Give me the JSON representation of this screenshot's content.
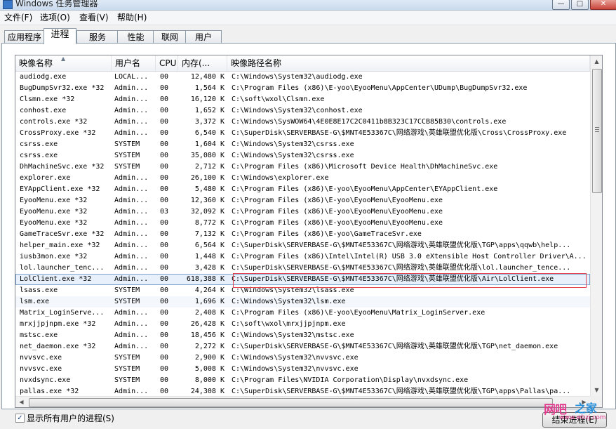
{
  "window": {
    "title": "Windows 任务管理器",
    "min_glyph": "—",
    "max_glyph": "□",
    "close_glyph": "✕"
  },
  "menu": [
    "文件(F)",
    "选项(O)",
    "查看(V)",
    "帮助(H)"
  ],
  "tabs": [
    "应用程序",
    "进程",
    "服务",
    "性能",
    "联网",
    "用户"
  ],
  "active_tab": "进程",
  "columns": {
    "name": "映像名称",
    "user": "用户名",
    "cpu": "CPU",
    "mem": "内存(...",
    "path": "映像路径名称"
  },
  "rows": [
    {
      "name": "audiodg.exe",
      "user": "LOCAL...",
      "cpu": "00",
      "mem": "12,480 K",
      "path": "C:\\Windows\\System32\\audiodg.exe"
    },
    {
      "name": "BugDumpSvr32.exe *32",
      "user": "Admin...",
      "cpu": "00",
      "mem": "1,564 K",
      "path": "C:\\Program Files (x86)\\E-yoo\\EyooMenu\\AppCenter\\UDump\\BugDumpSvr32.exe"
    },
    {
      "name": "Clsmn.exe *32",
      "user": "Admin...",
      "cpu": "00",
      "mem": "16,120 K",
      "path": "C:\\soft\\wxol\\Clsmn.exe"
    },
    {
      "name": "conhost.exe",
      "user": "Admin...",
      "cpu": "00",
      "mem": "1,652 K",
      "path": "C:\\Windows\\System32\\conhost.exe"
    },
    {
      "name": "controls.exe *32",
      "user": "Admin...",
      "cpu": "00",
      "mem": "3,372 K",
      "path": "C:\\Windows\\SysWOW64\\4E0E8E17C2C0411b8B323C17CCB85B30\\controls.exe"
    },
    {
      "name": "CrossProxy.exe *32",
      "user": "Admin...",
      "cpu": "00",
      "mem": "6,540 K",
      "path": "C:\\SuperDisk\\SERVERBASE-G\\$MNT4E53367C\\网络游戏\\英雄联盟优化版\\Cross\\CrossProxy.exe"
    },
    {
      "name": "csrss.exe",
      "user": "SYSTEM",
      "cpu": "00",
      "mem": "1,604 K",
      "path": "C:\\Windows\\System32\\csrss.exe"
    },
    {
      "name": "csrss.exe",
      "user": "SYSTEM",
      "cpu": "00",
      "mem": "35,080 K",
      "path": "C:\\Windows\\System32\\csrss.exe"
    },
    {
      "name": "DhMachineSvc.exe *32",
      "user": "SYSTEM",
      "cpu": "00",
      "mem": "2,712 K",
      "path": "C:\\Program Files (x86)\\Microsoft Device Health\\DhMachineSvc.exe"
    },
    {
      "name": "explorer.exe",
      "user": "Admin...",
      "cpu": "00",
      "mem": "26,100 K",
      "path": "C:\\Windows\\explorer.exe"
    },
    {
      "name": "EYAppClient.exe *32",
      "user": "Admin...",
      "cpu": "00",
      "mem": "5,480 K",
      "path": "C:\\Program Files (x86)\\E-yoo\\EyooMenu\\AppCenter\\EYAppClient.exe"
    },
    {
      "name": "EyooMenu.exe *32",
      "user": "Admin...",
      "cpu": "00",
      "mem": "12,360 K",
      "path": "C:\\Program Files (x86)\\E-yoo\\EyooMenu\\EyooMenu.exe"
    },
    {
      "name": "EyooMenu.exe *32",
      "user": "Admin...",
      "cpu": "03",
      "mem": "32,092 K",
      "path": "C:\\Program Files (x86)\\E-yoo\\EyooMenu\\EyooMenu.exe"
    },
    {
      "name": "EyooMenu.exe *32",
      "user": "Admin...",
      "cpu": "00",
      "mem": "8,772 K",
      "path": "C:\\Program Files (x86)\\E-yoo\\EyooMenu\\EyooMenu.exe"
    },
    {
      "name": "GameTraceSvr.exe *32",
      "user": "Admin...",
      "cpu": "00",
      "mem": "7,132 K",
      "path": "C:\\Program Files (x86)\\E-yoo\\GameTraceSvr.exe"
    },
    {
      "name": "helper_main.exe *32",
      "user": "Admin...",
      "cpu": "00",
      "mem": "6,564 K",
      "path": "C:\\SuperDisk\\SERVERBASE-G\\$MNT4E53367C\\网络游戏\\英雄联盟优化版\\TGP\\apps\\qqwb\\help..."
    },
    {
      "name": "iusb3mon.exe *32",
      "user": "Admin...",
      "cpu": "00",
      "mem": "1,448 K",
      "path": "C:\\Program Files (x86)\\Intel\\Intel(R) USB 3.0 eXtensible Host Controller Driver\\A..."
    },
    {
      "name": "lol.launcher_tenc...",
      "user": "Admin...",
      "cpu": "00",
      "mem": "3,428 K",
      "path": "C:\\SuperDisk\\SERVERBASE-G\\$MNT4E53367C\\网络游戏\\英雄联盟优化版\\lol.launcher_tence..."
    },
    {
      "name": "LolClient.exe *32",
      "user": "Admin...",
      "cpu": "00",
      "mem": "618,388 K",
      "path": "C:\\SuperDisk\\SERVERBASE-G\\$MNT4E53367C\\网络游戏\\英雄联盟优化版\\Air\\LolClient.exe"
    },
    {
      "name": "lsass.exe",
      "user": "SYSTEM",
      "cpu": "00",
      "mem": "4,264 K",
      "path": "C:\\Windows\\System32\\lsass.exe"
    },
    {
      "name": "lsm.exe",
      "user": "SYSTEM",
      "cpu": "00",
      "mem": "1,696 K",
      "path": "C:\\Windows\\System32\\lsm.exe"
    },
    {
      "name": "Matrix_LoginServe...",
      "user": "Admin...",
      "cpu": "00",
      "mem": "2,408 K",
      "path": "C:\\Program Files (x86)\\E-yoo\\EyooMenu\\Matrix_LoginServer.exe"
    },
    {
      "name": "mrxjjpjnpm.exe *32",
      "user": "Admin...",
      "cpu": "00",
      "mem": "26,428 K",
      "path": "C:\\soft\\wxol\\mrxjjpjnpm.exe"
    },
    {
      "name": "mstsc.exe",
      "user": "Admin...",
      "cpu": "00",
      "mem": "18,456 K",
      "path": "C:\\Windows\\System32\\mstsc.exe"
    },
    {
      "name": "net_daemon.exe *32",
      "user": "Admin...",
      "cpu": "00",
      "mem": "2,272 K",
      "path": "C:\\SuperDisk\\SERVERBASE-G\\$MNT4E53367C\\网络游戏\\英雄联盟优化版\\TGP\\net_daemon.exe"
    },
    {
      "name": "nvvsvc.exe",
      "user": "SYSTEM",
      "cpu": "00",
      "mem": "2,900 K",
      "path": "C:\\Windows\\System32\\nvvsvc.exe"
    },
    {
      "name": "nvvsvc.exe",
      "user": "SYSTEM",
      "cpu": "00",
      "mem": "5,008 K",
      "path": "C:\\Windows\\System32\\nvvsvc.exe"
    },
    {
      "name": "nvxdsync.exe",
      "user": "SYSTEM",
      "cpu": "00",
      "mem": "8,000 K",
      "path": "C:\\Program Files\\NVIDIA Corporation\\Display\\nvxdsync.exe"
    },
    {
      "name": "pallas.exe *32",
      "user": "Admin...",
      "cpu": "00",
      "mem": "24,308 K",
      "path": "C:\\SuperDisk\\SERVERBASE-G\\$MNT4E53367C\\网络游戏\\英雄联盟优化版\\TGP\\apps\\Pallas\\pa..."
    }
  ],
  "selected_row_index": 18,
  "hover_row_index": 20,
  "show_all_users": {
    "label": "显示所有用户的进程(S)",
    "checked": true,
    "check_glyph": "✓"
  },
  "end_process_label": "结束进程(E)",
  "watermark": {
    "text": "网吧",
    "text2": "之家",
    "url": "www.wbzj.com"
  },
  "colors": {
    "selection": "#e8f1fb",
    "highlight_box": "#e0454f"
  },
  "icons": {
    "sort": "▲",
    "up": "▲",
    "down": "▼",
    "left": "◀",
    "right": "▶"
  }
}
